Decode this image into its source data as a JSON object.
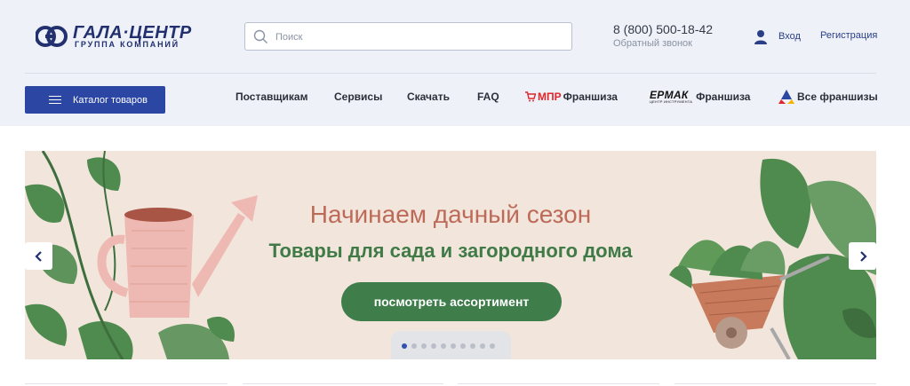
{
  "logo": {
    "title": "ГАЛА·ЦЕНТР",
    "subtitle": "ГРУППА КОМПАНИЙ"
  },
  "search": {
    "placeholder": "Поиск",
    "value": ""
  },
  "contacts": {
    "phone": "8 (800) 500-18-42",
    "callback": "Обратный звонок"
  },
  "account": {
    "login": "Вход",
    "register": "Регистрация"
  },
  "nav": {
    "catalog": "Каталог товаров",
    "items": [
      "Поставщикам",
      "Сервисы",
      "Скачать",
      "FAQ"
    ],
    "franchises": [
      {
        "brand": "МПР",
        "label": "Франшиза"
      },
      {
        "brand": "ЕРМАК",
        "brand_sub": "ЦЕНТР ИНСТРУМЕНТА",
        "label": "Франшиза"
      },
      {
        "label": "Все франшизы"
      }
    ]
  },
  "banner": {
    "title": "Начинаем дачный сезон",
    "subtitle": "Товары для сада и загородного дома",
    "button": "посмотреть ассортимент",
    "slides_total": 10,
    "active_slide": 1
  },
  "colors": {
    "brand": "#22306f",
    "primary": "#2c46a3",
    "banner_bg": "#f2e6dc",
    "title": "#bd6a58",
    "green": "#3f7d4b"
  }
}
